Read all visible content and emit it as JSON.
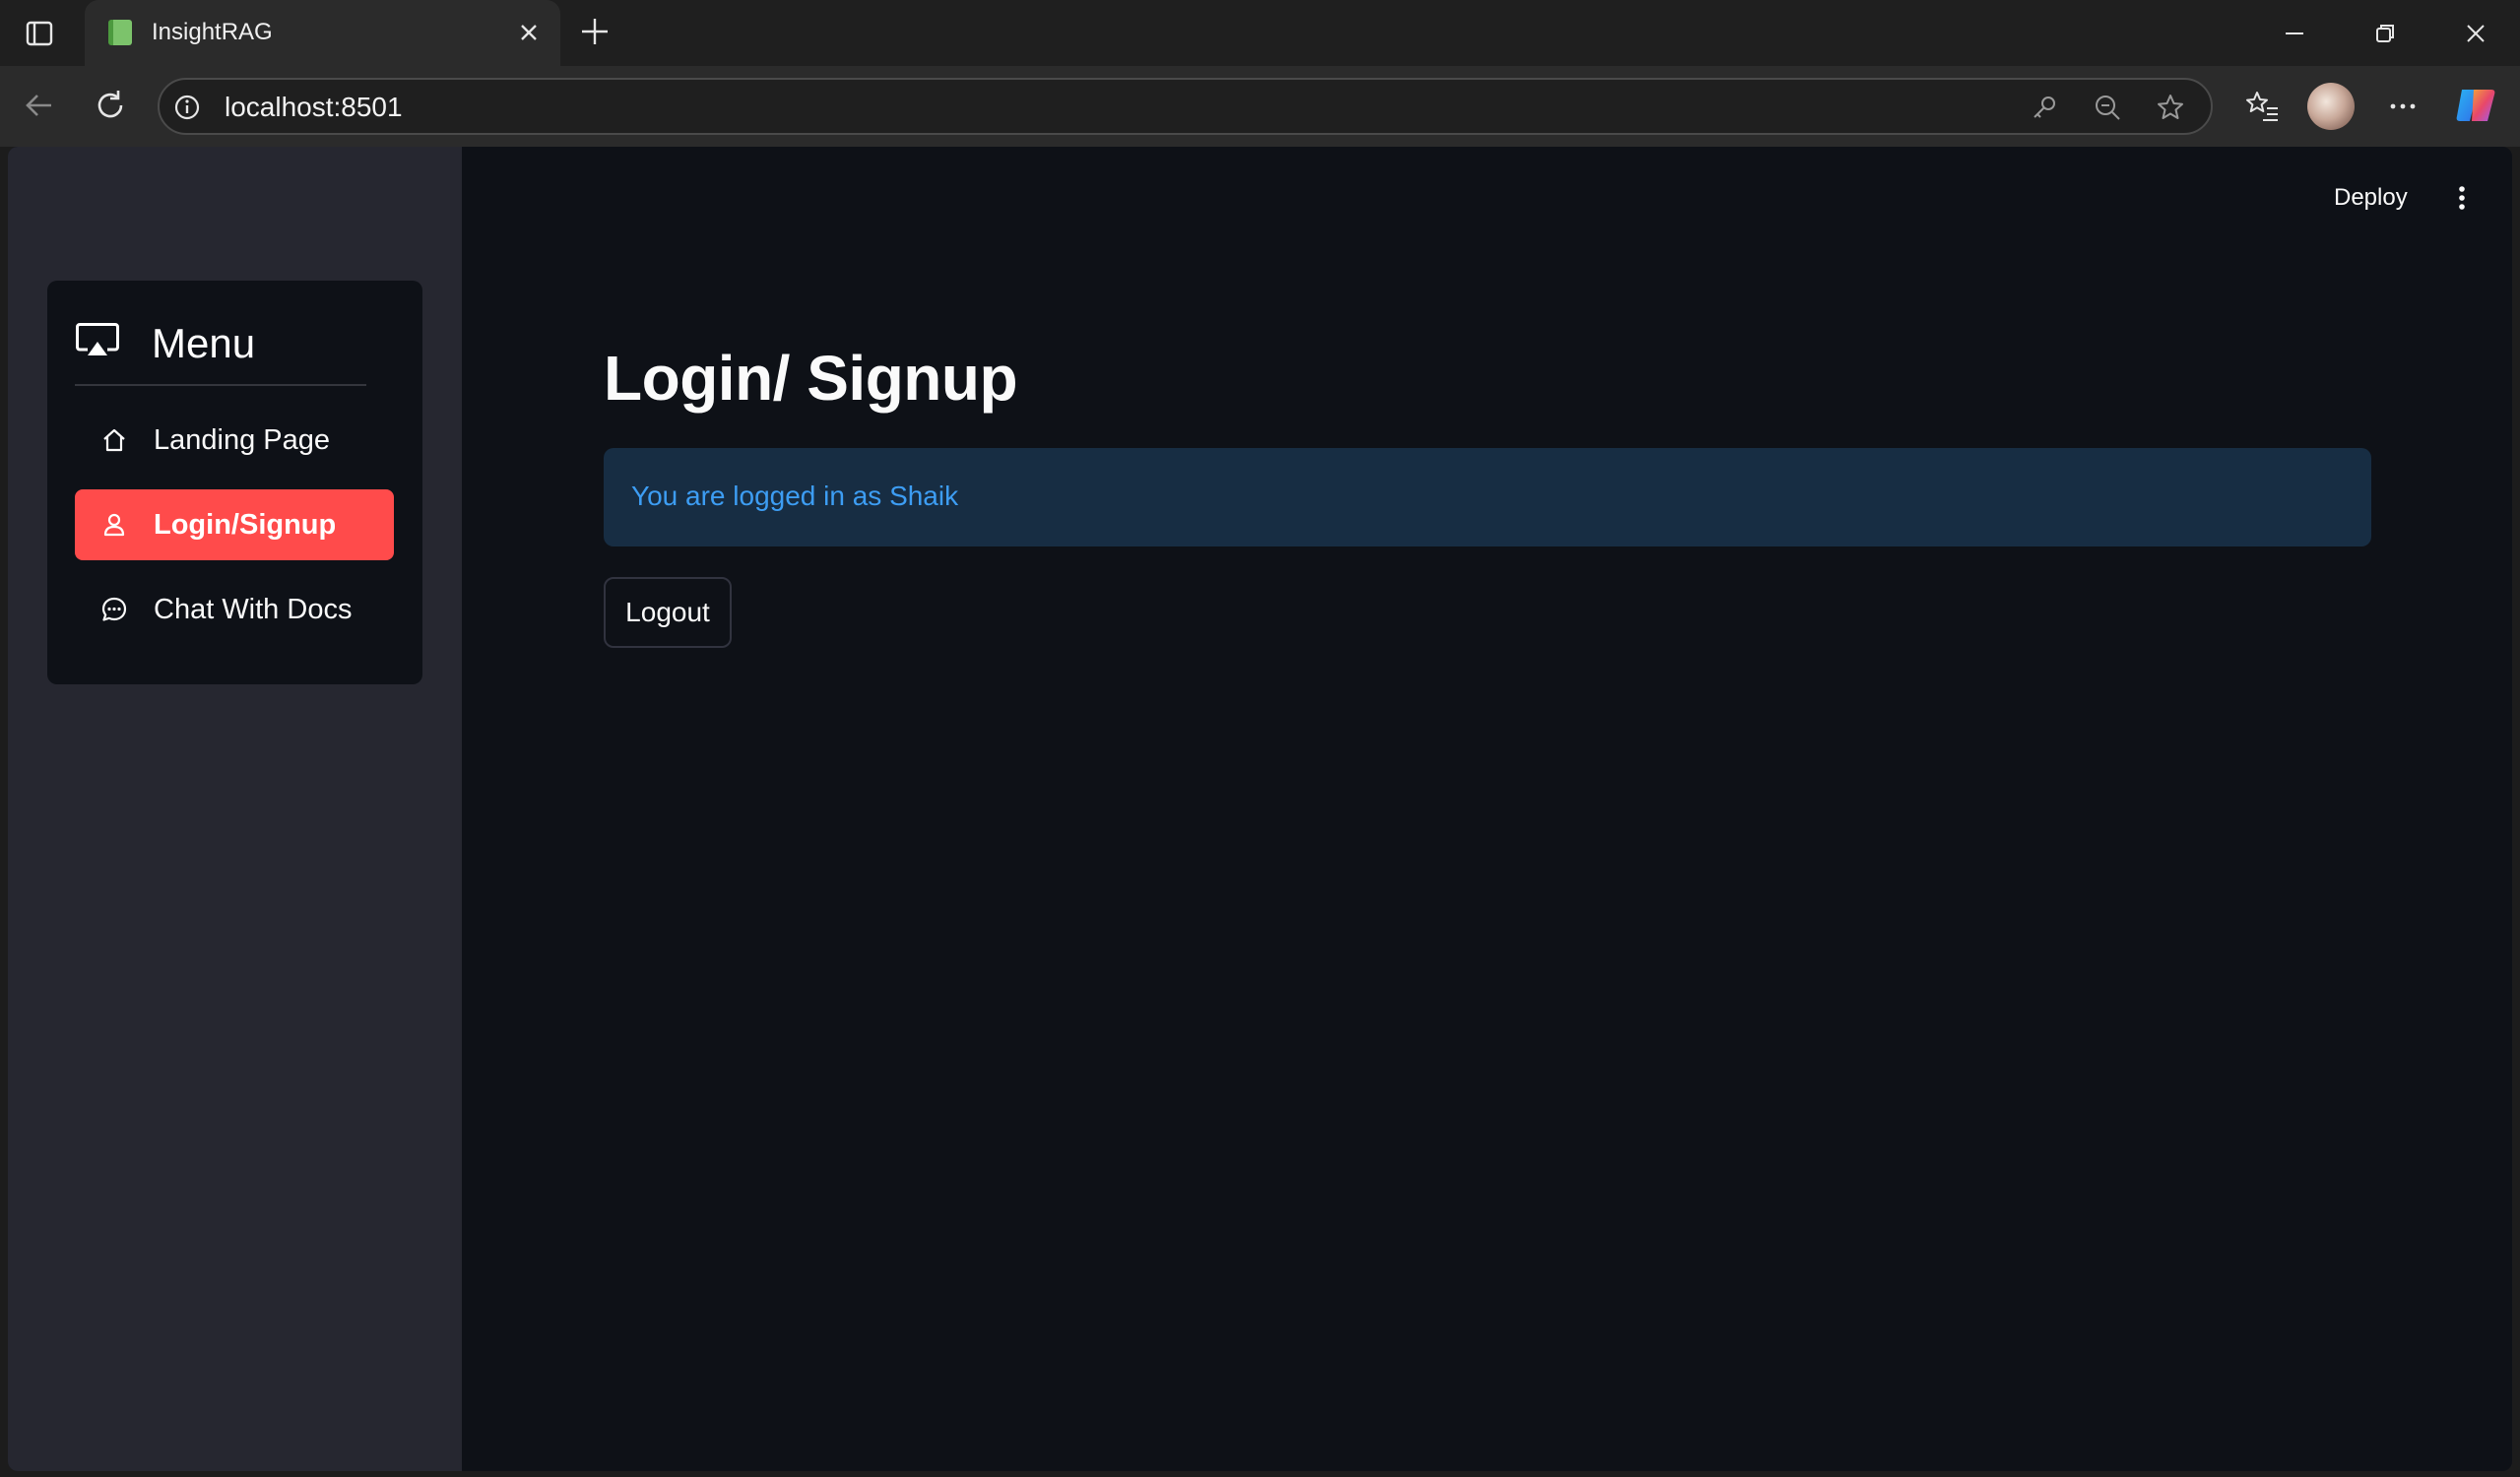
{
  "browser": {
    "tab_title": "InsightRAG",
    "url": "localhost:8501"
  },
  "app": {
    "header": {
      "deploy_label": "Deploy"
    },
    "sidebar": {
      "menu_title": "Menu",
      "items": [
        {
          "label": "Landing Page",
          "icon": "home-icon",
          "active": false
        },
        {
          "label": "Login/Signup",
          "icon": "person-icon",
          "active": true
        },
        {
          "label": "Chat With Docs",
          "icon": "chat-icon",
          "active": false
        }
      ]
    },
    "main": {
      "title": "Login/ Signup",
      "info_message": "You are logged in as Shaik",
      "logout_label": "Logout"
    }
  },
  "colors": {
    "accent": "#ff4b4b",
    "background": "#0e1117",
    "sidebar_bg": "#262730",
    "info_bg": "#172d43",
    "info_text": "#3d9df3"
  }
}
